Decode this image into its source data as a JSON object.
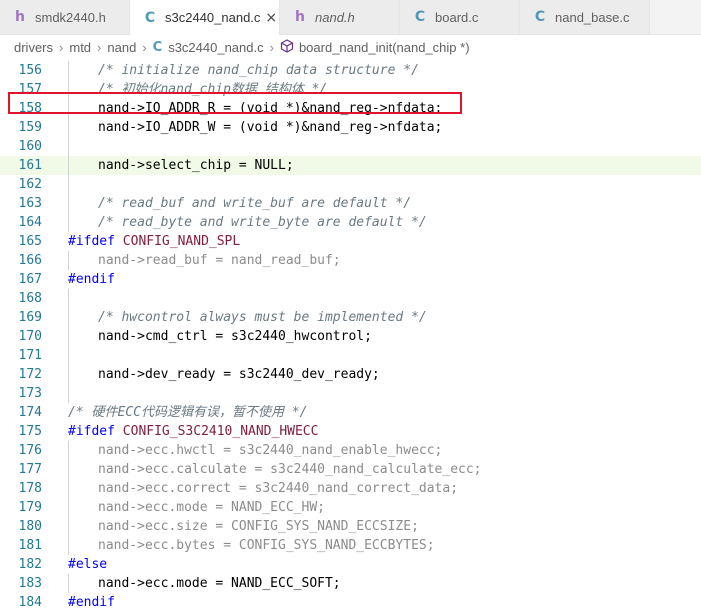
{
  "tabs": [
    {
      "icon": "h",
      "label": "smdk2440.h",
      "italic": false,
      "active": false
    },
    {
      "icon": "C",
      "label": "s3c2440_nand.c",
      "italic": false,
      "active": true,
      "close": "×"
    },
    {
      "icon": "h",
      "label": "nand.h",
      "italic": true,
      "active": false
    },
    {
      "icon": "C",
      "label": "board.c",
      "italic": false,
      "active": false
    },
    {
      "icon": "C",
      "label": "nand_base.c",
      "italic": false,
      "active": false
    }
  ],
  "breadcrumb": {
    "items": [
      "drivers",
      "mtd",
      "nand"
    ],
    "file_icon": "C",
    "file": "s3c2440_nand.c",
    "symbol": "board_nand_init(nand_chip *)"
  },
  "highlighted_line": 161,
  "lines": [
    {
      "n": "156",
      "indent": true,
      "segs": [
        [
          "cm",
          "/* initialize nand_chip data structure */"
        ]
      ]
    },
    {
      "n": "157",
      "indent": true,
      "segs": [
        [
          "cm",
          "/* 初始化nand_chip数据 结构体 */"
        ]
      ]
    },
    {
      "n": "158",
      "indent": true,
      "segs": [
        [
          "t",
          "nand->IO_ADDR_R = (void *)&nand_reg->nfdata;"
        ]
      ]
    },
    {
      "n": "159",
      "indent": true,
      "segs": [
        [
          "t",
          "nand->IO_ADDR_W = (void *)&nand_reg->nfdata;"
        ]
      ]
    },
    {
      "n": "160",
      "indent": true,
      "segs": []
    },
    {
      "n": "161",
      "indent": true,
      "segs": [
        [
          "t",
          "nand->select_chip = NULL;"
        ]
      ]
    },
    {
      "n": "162",
      "indent": true,
      "segs": []
    },
    {
      "n": "163",
      "indent": true,
      "segs": [
        [
          "cm",
          "/* read_buf and write_buf are default */"
        ]
      ]
    },
    {
      "n": "164",
      "indent": true,
      "segs": [
        [
          "cm",
          "/* read_byte and write_byte are default */"
        ]
      ]
    },
    {
      "n": "165",
      "indent": false,
      "segs": [
        [
          "pp",
          "#ifdef "
        ],
        [
          "mac",
          "CONFIG_NAND_SPL"
        ]
      ]
    },
    {
      "n": "166",
      "indent": true,
      "segs": [
        [
          "dim",
          "nand->read_buf = nand_read_buf;"
        ]
      ]
    },
    {
      "n": "167",
      "indent": false,
      "segs": [
        [
          "pp",
          "#endif"
        ]
      ]
    },
    {
      "n": "168",
      "indent": true,
      "segs": []
    },
    {
      "n": "169",
      "indent": true,
      "segs": [
        [
          "cm",
          "/* hwcontrol always must be implemented */"
        ]
      ]
    },
    {
      "n": "170",
      "indent": true,
      "segs": [
        [
          "t",
          "nand->cmd_ctrl = s3c2440_hwcontrol;"
        ]
      ]
    },
    {
      "n": "171",
      "indent": true,
      "segs": []
    },
    {
      "n": "172",
      "indent": true,
      "segs": [
        [
          "t",
          "nand->dev_ready = s3c2440_dev_ready;"
        ]
      ]
    },
    {
      "n": "173",
      "indent": true,
      "segs": []
    },
    {
      "n": "174",
      "indent": false,
      "segs": [
        [
          "cm",
          "/* 硬件ECC代码逻辑有误，暂不使用 */"
        ]
      ]
    },
    {
      "n": "175",
      "indent": false,
      "segs": [
        [
          "pp",
          "#ifdef "
        ],
        [
          "mac",
          "CONFIG_S3C2410_NAND_HWECC"
        ]
      ]
    },
    {
      "n": "176",
      "indent": true,
      "segs": [
        [
          "dim",
          "nand->ecc.hwctl = s3c2440_nand_enable_hwecc;"
        ]
      ]
    },
    {
      "n": "177",
      "indent": true,
      "segs": [
        [
          "dim",
          "nand->ecc.calculate = s3c2440_nand_calculate_ecc;"
        ]
      ]
    },
    {
      "n": "178",
      "indent": true,
      "segs": [
        [
          "dim",
          "nand->ecc.correct = s3c2440_nand_correct_data;"
        ]
      ]
    },
    {
      "n": "179",
      "indent": true,
      "segs": [
        [
          "dim",
          "nand->ecc.mode = NAND_ECC_HW;"
        ]
      ]
    },
    {
      "n": "180",
      "indent": true,
      "segs": [
        [
          "dim",
          "nand->ecc.size = CONFIG_SYS_NAND_ECCSIZE;"
        ]
      ]
    },
    {
      "n": "181",
      "indent": true,
      "segs": [
        [
          "dim",
          "nand->ecc.bytes = CONFIG_SYS_NAND_ECCBYTES;"
        ]
      ]
    },
    {
      "n": "182",
      "indent": false,
      "segs": [
        [
          "pp",
          "#else"
        ]
      ]
    },
    {
      "n": "183",
      "indent": true,
      "segs": [
        [
          "t",
          "nand->ecc.mode = NAND_ECC_SOFT;"
        ]
      ]
    },
    {
      "n": "184",
      "indent": false,
      "segs": [
        [
          "pp",
          "#endif"
        ]
      ]
    }
  ]
}
